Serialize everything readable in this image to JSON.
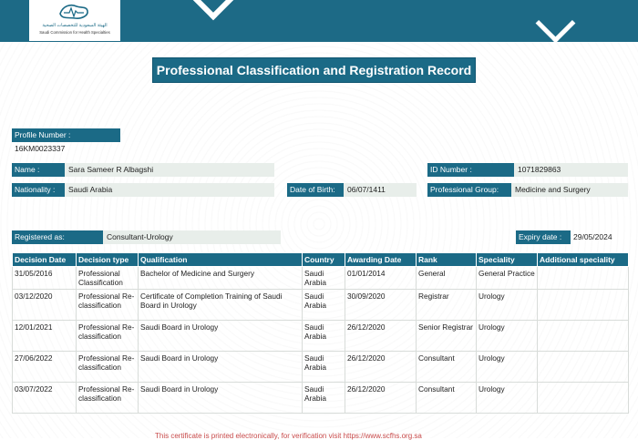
{
  "logo": {
    "arabic_name": "الهيئة السعودية للتخصصات الصحية",
    "english_name": "Saudi Commission for Health Specialties"
  },
  "document": {
    "title": "Professional Classification and Registration Record"
  },
  "profile": {
    "profile_number_label": "Profile Number :",
    "profile_number": "16KM0023337",
    "name_label": "Name :",
    "name": "Sara Sameer R Albagshi",
    "id_number_label": "ID Number :",
    "id_number": "1071829863",
    "nationality_label": "Nationality :",
    "nationality": "Saudi Arabia",
    "dob_label": "Date of Birth:",
    "dob": "06/07/1411",
    "professional_group_label": "Professional Group:",
    "professional_group": "Medicine and Surgery"
  },
  "registration": {
    "registered_as_label": "Registered as:",
    "registered_as": "Consultant-Urology",
    "expiry_label": "Expiry date :",
    "expiry": "29/05/2024"
  },
  "table": {
    "headers": [
      "Decision Date",
      "Decision type",
      "Qualification",
      "Country",
      "Awarding Date",
      "Rank",
      "Speciality",
      "Additional speciality"
    ],
    "rows": [
      [
        "31/05/2016",
        "Professional Classification",
        "Bachelor of Medicine and Surgery",
        "Saudi Arabia",
        "01/01/2014",
        "General",
        "General Practice",
        ""
      ],
      [
        "03/12/2020",
        "Professional Re-classification",
        "Certificate of Completion Training of Saudi Board in Urology",
        "Saudi Arabia",
        "30/09/2020",
        "Registrar",
        "Urology",
        ""
      ],
      [
        "12/01/2021",
        "Professional Re-classification",
        "Saudi Board in Urology",
        "Saudi Arabia",
        "26/12/2020",
        "Senior Registrar",
        "Urology",
        ""
      ],
      [
        "27/06/2022",
        "Professional Re-classification",
        "Saudi Board in Urology",
        "Saudi Arabia",
        "26/12/2020",
        "Consultant",
        "Urology",
        ""
      ],
      [
        "03/07/2022",
        "Professional Re-classification",
        "Saudi Board in Urology",
        "Saudi Arabia",
        "26/12/2020",
        "Consultant",
        "Urology",
        ""
      ]
    ]
  },
  "footer": {
    "note": "This certificate is printed electronically, for verification visit https://www.scfhs.org.sa"
  },
  "colors": {
    "brand": "#1b6a86",
    "value_bg": "#e8eeea",
    "footer_text": "#c84b4b"
  }
}
